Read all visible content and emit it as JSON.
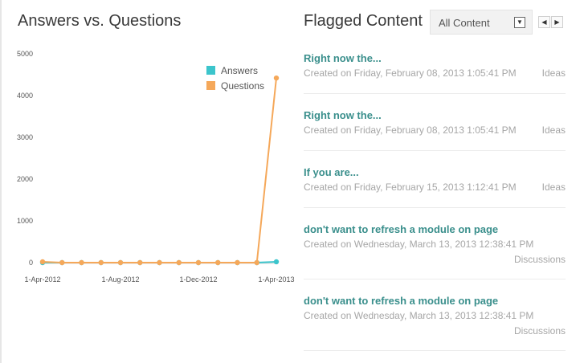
{
  "chart_panel": {
    "title": "Answers vs. Questions"
  },
  "chart_data": {
    "type": "line",
    "x": [
      "2012-04-01",
      "2012-05-01",
      "2012-06-01",
      "2012-07-01",
      "2012-08-01",
      "2012-09-01",
      "2012-10-01",
      "2012-11-01",
      "2012-12-01",
      "2013-01-01",
      "2013-02-01",
      "2013-03-01",
      "2013-04-01"
    ],
    "x_tick_labels": [
      "1-Apr-2012",
      "1-Aug-2012",
      "1-Dec-2012",
      "1-Apr-2013"
    ],
    "x_tick_index": [
      0,
      4,
      8,
      12
    ],
    "y_ticks": [
      0,
      1000,
      2000,
      3000,
      4000,
      5000
    ],
    "ylim": [
      0,
      5000
    ],
    "legend_position": "top-right",
    "grid": false,
    "series": [
      {
        "name": "Answers",
        "color": "#3cc5cc",
        "values": [
          0,
          0,
          0,
          0,
          0,
          0,
          0,
          0,
          0,
          0,
          0,
          0,
          20
        ]
      },
      {
        "name": "Questions",
        "color": "#f5a85a",
        "values": [
          20,
          0,
          0,
          0,
          0,
          0,
          0,
          0,
          0,
          0,
          0,
          0,
          4420
        ]
      }
    ]
  },
  "flagged": {
    "title": "Flagged Content",
    "filter": {
      "selected": "All Content",
      "arrow": "▼"
    },
    "pager": {
      "prev": "◀",
      "next": "▶"
    },
    "items": [
      {
        "title": "Right now the...",
        "meta": "Created on Friday, February 08, 2013 1:05:41 PM",
        "category": "Ideas"
      },
      {
        "title": "Right now the...",
        "meta": "Created on Friday, February 08, 2013 1:05:41 PM",
        "category": "Ideas"
      },
      {
        "title": "If you are...",
        "meta": "Created on Friday, February 15, 2013 1:12:41 PM",
        "category": "Ideas"
      },
      {
        "title": "don't want to refresh a module on page",
        "meta": "Created on Wednesday, March 13, 2013 12:38:41 PM",
        "category": "Discussions"
      },
      {
        "title": "don't want to refresh a module on page",
        "meta": "Created on Wednesday, March 13, 2013 12:38:41 PM",
        "category": "Discussions"
      }
    ]
  }
}
